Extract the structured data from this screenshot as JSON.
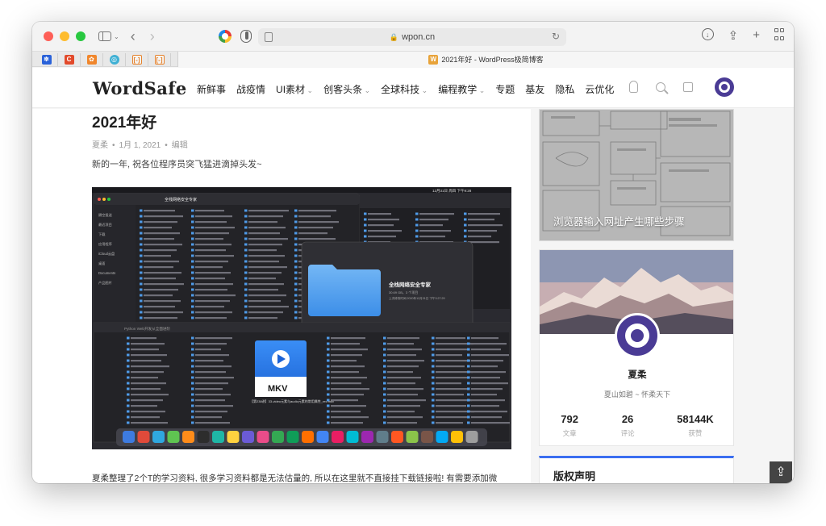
{
  "browser": {
    "address": "wpon.cn",
    "tab_title": "2021年好 - WordPress极简博客",
    "tab_favicon": "W"
  },
  "site": {
    "logo": "WordSafe",
    "nav": [
      "新鲜事",
      "战疫情",
      "UI素材",
      "创客头条",
      "全球科技",
      "编程教学",
      "专题",
      "基友",
      "隐私",
      "云优化"
    ],
    "nav_dropdowns": [
      false,
      false,
      true,
      true,
      true,
      true,
      false,
      false,
      false,
      false
    ]
  },
  "post": {
    "title": "2021年好",
    "author": "夏柔",
    "date": "1月 1, 2021",
    "edit": "编辑",
    "intro": "新的一年, 祝各位程序员突飞猛进滴掉头发~",
    "paragraph": "夏柔整理了2个T的学习资料, 很多学习资料都是无法估量的, 所以在这里就不直接挂下载链接啦! 有需要添加微",
    "screenshot": {
      "window_title": "全栈网络安全专家",
      "folder_name": "全栈网络安全专家",
      "folder_info": "30.69 GB，3 个项目",
      "folder_date": "上次修改时间 2020年12月31日 下午3:27:29",
      "menubar_time": "12月31日 周四 下午9:28",
      "mkv_label": "MKV",
      "mkv_caption": "【第238讲】33-video元素与audio元素的常用属性_rec.mkv",
      "second_window_title": "Python Web开发从全面进阶",
      "sidebar_items": [
        "隔空投送",
        "最近项目",
        "下载",
        "应用程序",
        "iCloud云盘",
        "桌面",
        "Documents",
        "产品图片"
      ]
    }
  },
  "sidebar": {
    "card1_caption": "浏览器输入网址产生哪些步骤",
    "profile": {
      "name": "夏柔",
      "motto": "夏山如碧 ~ 怀柔天下",
      "stats": [
        {
          "value": "792",
          "label": "文章"
        },
        {
          "value": "26",
          "label": "评论"
        },
        {
          "value": "58144K",
          "label": "获赞"
        }
      ]
    },
    "card3_title": "版权声明"
  },
  "colors": {
    "accent": "#3b6ef0",
    "github_purple": "#4a3b95",
    "wp_orange": "#e8a33a"
  }
}
